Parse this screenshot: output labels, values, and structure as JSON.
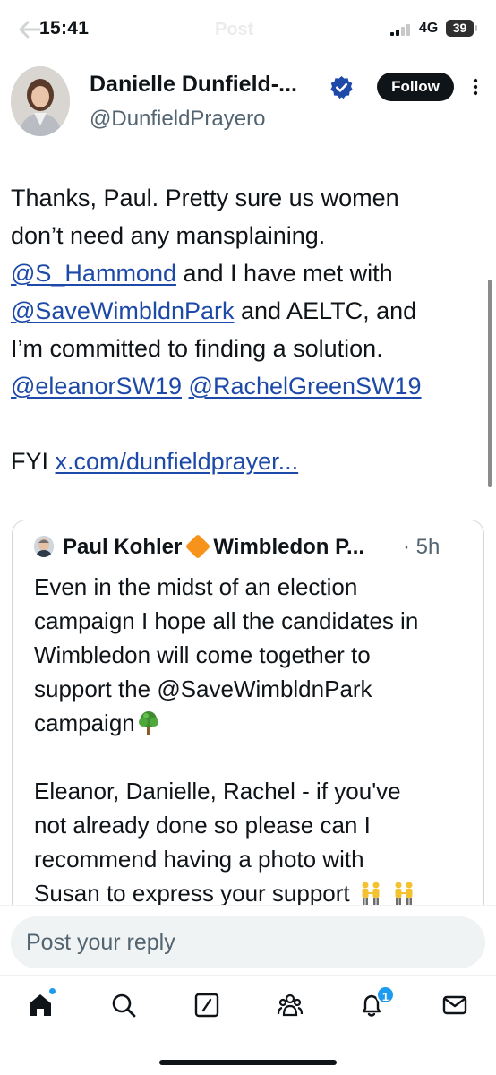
{
  "status_bar": {
    "time": "15:41",
    "network": "4G",
    "battery": "39"
  },
  "header": {
    "title": "Post",
    "back_icon": "back-arrow-icon"
  },
  "post": {
    "author_name": "Danielle Dunfield-...",
    "author_handle": "@DunfieldPrayero",
    "verified_icon": "verified-badge-icon",
    "follow_label": "Follow",
    "more_icon": "more-options-icon",
    "text": {
      "line1": "Thanks, Paul. Pretty sure us women",
      "line2": "don’t need any mansplaining.",
      "mention_hammond": "@S_Hammond",
      "line3_rest": " and I have met with",
      "mention_savewimbledonpark": "@SaveWimbldnPark",
      "line4_rest": " and AELTC, and",
      "line5": "I’m committed to finding a solution.",
      "mention_eleanor": "@eleanorSW19",
      "mention_rachel": "@RachelGreenSW19",
      "fyi_prefix": "FYI ",
      "link": "x.com/dunfieldprayer..."
    }
  },
  "quoted_post": {
    "author_name_part1": "Paul Kohler",
    "author_name_part2": "Wimbledon P...",
    "diamond_icon": "orange-diamond-icon",
    "time": "· 5h",
    "lines": [
      "Even in the midst of an election",
      "campaign I hope all the candidates in",
      "Wimbledon will come together to",
      "support the @SaveWimbldnPark",
      "campaign",
      "",
      "Eleanor, Danielle, Rachel - if you've",
      "not already done so please can I",
      "recommend having a photo with",
      "Susan to express your support"
    ],
    "tree_icon": "tree-emoji-icon",
    "people_icon": "people-holding-hands-emoji-icon"
  },
  "reply": {
    "placeholder": "Post your reply"
  },
  "bottom_nav": {
    "items": [
      "home-icon",
      "search-icon",
      "grok-icon",
      "communities-icon",
      "notifications-icon",
      "messages-icon"
    ],
    "notification_count": "1"
  },
  "colors": {
    "link": "#1d4aa8",
    "accent": "#1d9bf0",
    "text": "#0f1419",
    "muted": "#536471"
  }
}
